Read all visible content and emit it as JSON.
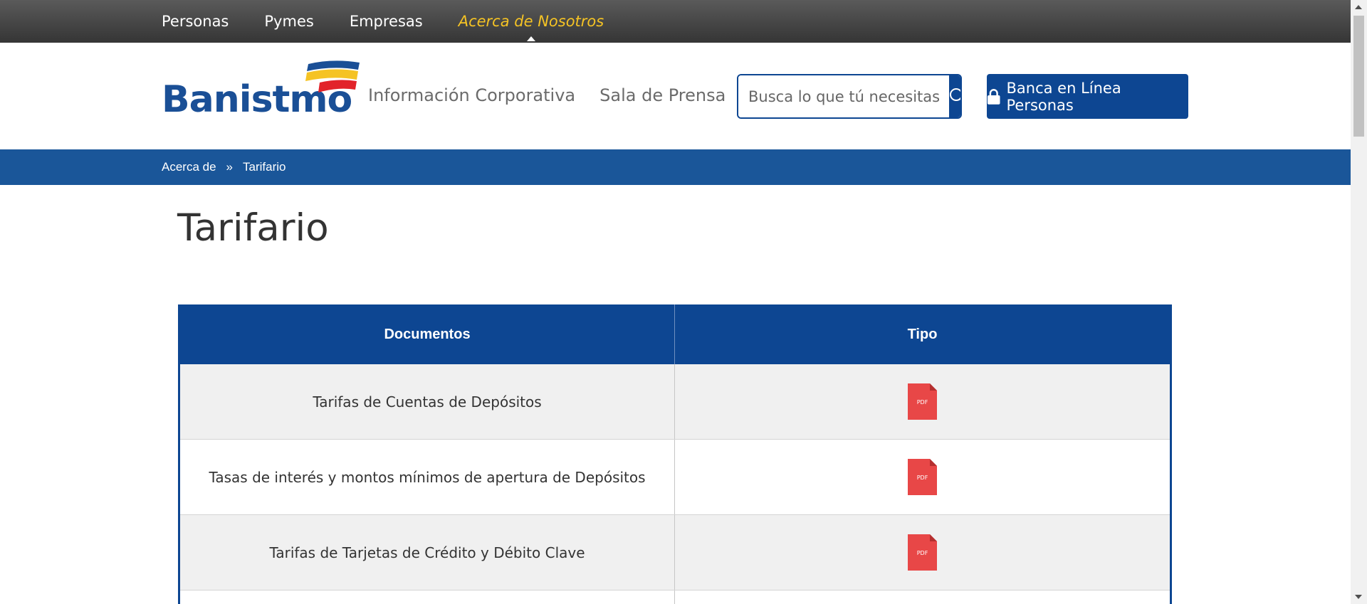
{
  "top_nav": {
    "items": [
      {
        "label": "Personas",
        "active": false
      },
      {
        "label": "Pymes",
        "active": false
      },
      {
        "label": "Empresas",
        "active": false
      },
      {
        "label": "Acerca de Nosotros",
        "active": true
      }
    ]
  },
  "header": {
    "logo_text": "Banistmo",
    "nav": [
      {
        "label": "Información Corporativa"
      },
      {
        "label": "Sala de Prensa"
      }
    ],
    "search": {
      "placeholder": "Busca lo que tú necesitas"
    },
    "banca_button": "Banca en Línea Personas"
  },
  "breadcrumb": {
    "items": [
      "Acerca de",
      "Tarifario"
    ],
    "separator": "»"
  },
  "page": {
    "title": "Tarifario"
  },
  "table": {
    "headers": [
      "Documentos",
      "Tipo"
    ],
    "rows": [
      {
        "document": "Tarifas de Cuentas de Depósitos",
        "type": "PDF"
      },
      {
        "document": "Tasas de interés y montos mínimos de apertura de Depósitos",
        "type": "PDF"
      },
      {
        "document": "Tarifas de Tarjetas de Crédito y Débito Clave",
        "type": "PDF"
      }
    ]
  },
  "colors": {
    "brand_blue": "#0d4692",
    "breadcrumb_blue": "#1a5699",
    "active_nav": "#f5c324",
    "pdf_red": "#e84747"
  }
}
